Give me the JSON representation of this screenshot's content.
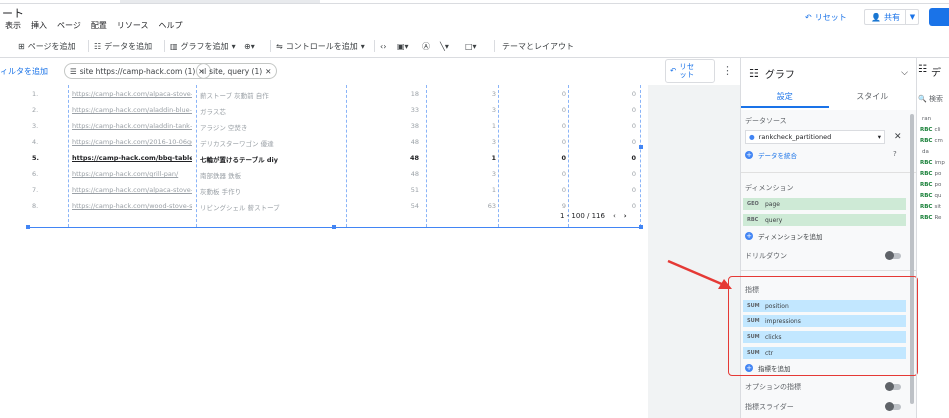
{
  "app": {
    "title": "ート"
  },
  "menu": [
    "表示",
    "挿入",
    "ページ",
    "配置",
    "リソース",
    "ヘルプ"
  ],
  "header": {
    "reset_label": "リセット",
    "share_label": "共有"
  },
  "toolbar": {
    "add_page": "ページを追加",
    "add_data": "データを追加",
    "add_chart": "グラフを追加",
    "add_control": "コントロールを追加",
    "theme_layout": "テーマとレイアウト"
  },
  "filterbar": {
    "add_filter": "ィルタを追加",
    "chip1": "site https://camp-hack.com (1)",
    "chip2": "site, query (1)",
    "reset": "リセ\nット"
  },
  "table": {
    "rows": [
      {
        "n": "1.",
        "url": "https://camp-hack.com/alpaca-stove-h...",
        "q": "薪ストーブ 灰動前 自作",
        "a": "18",
        "b": "3",
        "c": "0",
        "d": "0",
        "bold": false
      },
      {
        "n": "2.",
        "url": "https://camp-hack.com/aladdin-blue-fl...",
        "q": "ガラス芯",
        "a": "33",
        "b": "3",
        "c": "0",
        "d": "0",
        "bold": false
      },
      {
        "n": "3.",
        "url": "https://camp-hack.com/aladdin-tank-ts...",
        "q": "アラジン 空焚き",
        "a": "38",
        "b": "1",
        "c": "0",
        "d": "0",
        "bold": false
      },
      {
        "n": "4.",
        "url": "https://camp-hack.com/2016-10-06go...",
        "q": "デリカスターワゴン 優達",
        "a": "48",
        "b": "3",
        "c": "0",
        "d": "0",
        "bold": false
      },
      {
        "n": "5.",
        "url": "https://camp-hack.com/bbq-table-diy/",
        "q": "七輪が置けるテーブル diy",
        "a": "48",
        "b": "1",
        "c": "0",
        "d": "0",
        "bold": true
      },
      {
        "n": "6.",
        "url": "https://camp-hack.com/grill-pan/",
        "q": "南部鉄器 鉄板",
        "a": "48",
        "b": "3",
        "c": "0",
        "d": "0",
        "bold": false
      },
      {
        "n": "7.",
        "url": "https://camp-hack.com/alpaca-stove-h...",
        "q": "灰動板 手作り",
        "a": "51",
        "b": "1",
        "c": "0",
        "d": "0",
        "bold": false
      },
      {
        "n": "8.",
        "url": "https://camp-hack.com/wood-stove-se...",
        "q": "リビングシェル 薪ストーブ",
        "a": "54",
        "b": "63",
        "c": "9",
        "d": "0",
        "bold": false
      }
    ],
    "pager": "1 - 100 / 116"
  },
  "panel": {
    "title": "グラフ",
    "tab_setup": "設定",
    "tab_style": "スタイル",
    "datasource_label": "データソース",
    "datasource": "rankcheck_partitioned",
    "blend_data": "データを統合",
    "dimension_label": "ディメンション",
    "dimensions": [
      {
        "tag": "GEO",
        "name": "page"
      },
      {
        "tag": "RBC",
        "name": "query"
      }
    ],
    "add_dimension": "ディメンションを追加",
    "drilldown": "ドリルダウン",
    "metric_label": "指標",
    "metrics": [
      {
        "tag": "SUM",
        "name": "position"
      },
      {
        "tag": "SUM",
        "name": "impressions"
      },
      {
        "tag": "SUM",
        "name": "clicks"
      },
      {
        "tag": "SUM",
        "name": "ctr"
      }
    ],
    "add_metric": "指標を追加",
    "optional_metrics": "オプションの指標",
    "metric_slider": "指標スライダー"
  },
  "data_panel": {
    "title": "デ",
    "search": "検索",
    "fields": [
      {
        "tag": "",
        "name": "ran"
      },
      {
        "tag": "RBC",
        "name": "cli"
      },
      {
        "tag": "RBC",
        "name": "cm"
      },
      {
        "tag": "",
        "name": "da"
      },
      {
        "tag": "RBC",
        "name": "imp"
      },
      {
        "tag": "RBC",
        "name": "po"
      },
      {
        "tag": "RBC",
        "name": "po"
      },
      {
        "tag": "RBC",
        "name": "qu"
      },
      {
        "tag": "RBC",
        "name": "sit"
      },
      {
        "tag": "RBC",
        "name": "Re"
      }
    ]
  }
}
